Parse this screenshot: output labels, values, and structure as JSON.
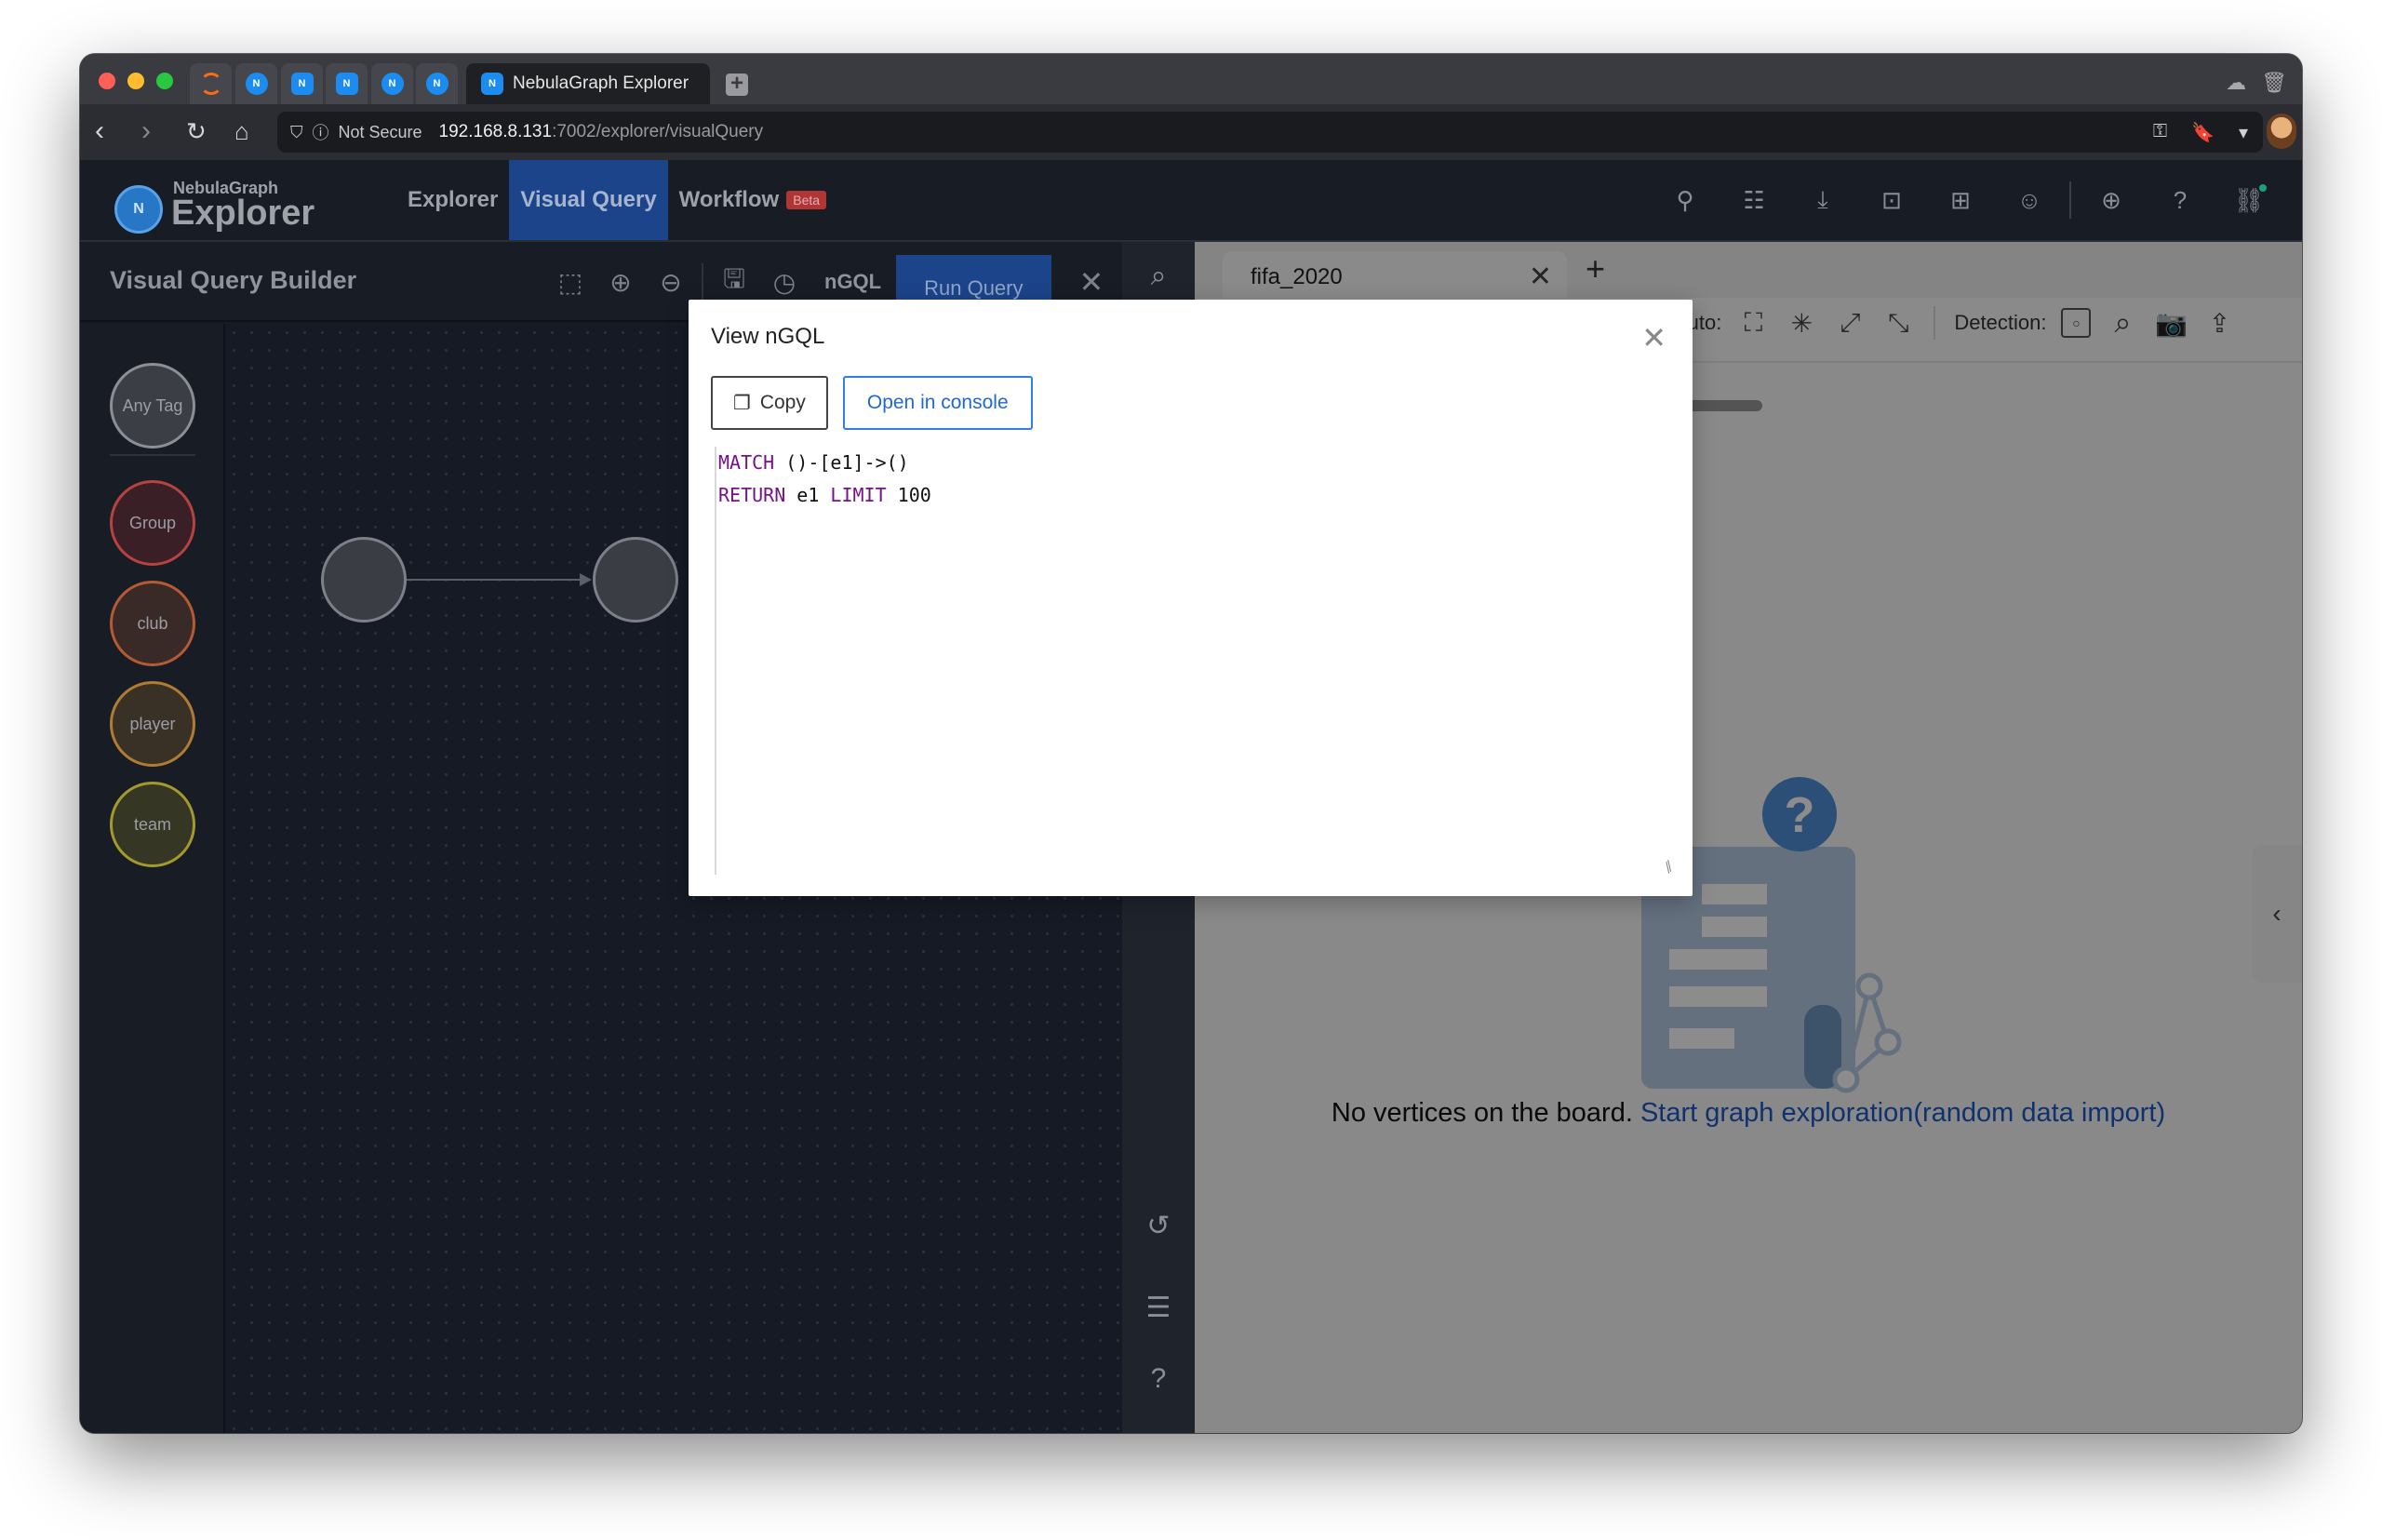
{
  "browser": {
    "active_tab_title": "NebulaGraph Explorer",
    "pinned_tabs": [
      "orange-loader-favicon",
      "nebula-favicon",
      "nebula-cloud-favicon",
      "nebula-cloud-favicon",
      "nebula-favicon",
      "nebula-favicon"
    ],
    "security_label": "Not Secure",
    "url_host": "192.168.8.131",
    "url_path": ":7002/explorer/visualQuery"
  },
  "app": {
    "logo_small": "NebulaGraph",
    "logo_big": "Explorer",
    "nav": [
      {
        "label": "Explorer",
        "active": false
      },
      {
        "label": "Visual Query",
        "active": true
      },
      {
        "label": "Workflow",
        "active": false,
        "badge": "Beta"
      }
    ],
    "header_icons": [
      "schema-icon",
      "tree-icon",
      "import-icon",
      "console-icon",
      "layout-icon",
      "users-icon",
      "globe-icon",
      "help-icon",
      "connection-icon"
    ],
    "accent_color": "#1c448a",
    "beta_color": "#b13535"
  },
  "builder": {
    "title": "Visual Query Builder",
    "ngql_label": "nGQL",
    "run_label": "Run Query",
    "tags": [
      {
        "label": "Any Tag",
        "color": "#8c8f95",
        "fill": "#3b3e45"
      },
      {
        "label": "Group",
        "color": "#b6433f",
        "fill": "#3a2026"
      },
      {
        "label": "club",
        "color": "#b55b34",
        "fill": "#3a2a27"
      },
      {
        "label": "player",
        "color": "#b07c32",
        "fill": "#3a3126"
      },
      {
        "label": "team",
        "color": "#a39a2e",
        "fill": "#363624"
      }
    ]
  },
  "explorer_panel": {
    "tab_label": "fifa_2020",
    "auto_label": "Auto:",
    "detection_label": "Detection:",
    "empty_text": "No vertices on the board.",
    "empty_link": "Start graph exploration(random data import)"
  },
  "modal": {
    "title": "View nGQL",
    "copy_label": "Copy",
    "console_label": "Open in console",
    "code_lines": [
      [
        {
          "t": "MATCH",
          "kw": true
        },
        {
          "t": " ()-[e1]->()",
          "kw": false
        }
      ],
      [
        {
          "t": "RETURN",
          "kw": true
        },
        {
          "t": " e1 ",
          "kw": false
        },
        {
          "t": "LIMIT",
          "kw": true
        },
        {
          "t": " 100",
          "kw": false
        }
      ]
    ]
  }
}
